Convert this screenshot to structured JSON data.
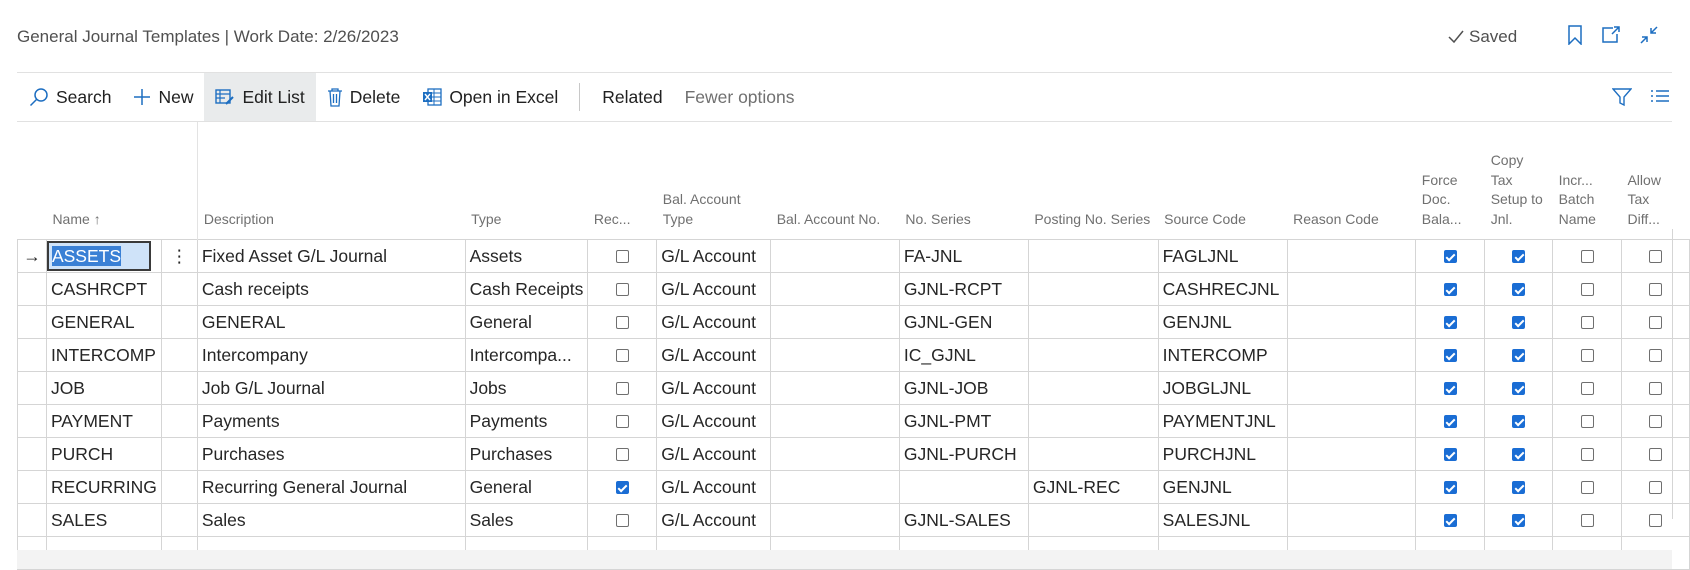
{
  "header": {
    "title": "General Journal Templates | Work Date: 2/26/2023",
    "saved_label": "Saved",
    "icons": [
      "bookmark-icon",
      "open-new-window-icon",
      "collapse-icon"
    ]
  },
  "actions": {
    "search": "Search",
    "new": "New",
    "edit_list": "Edit List",
    "delete": "Delete",
    "open_in_excel": "Open in Excel",
    "related": "Related",
    "fewer_options": "Fewer options",
    "icons": [
      "filter-icon",
      "list-view-icon"
    ]
  },
  "columns": {
    "name": "Name",
    "description": "Description",
    "type": "Type",
    "recurring": "Rec...",
    "bal_account_type": "Bal. Account Type",
    "bal_account_no": "Bal. Account No.",
    "no_series": "No. Series",
    "posting_no_series": "Posting No. Series",
    "source_code": "Source Code",
    "reason_code": "Reason Code",
    "force_doc_balance": "Force Doc. Bala...",
    "copy_tax_setup": "Copy Tax Setup to Jnl.",
    "incr_batch_name": "Incr... Batch Name",
    "allow_tax_diff": "Allow Tax Diff..."
  },
  "sort_indicator": "↑",
  "rows": [
    {
      "name": "ASSETS",
      "description": "Fixed Asset G/L Journal",
      "type": "Assets",
      "recurring": false,
      "bal_account_type": "G/L Account",
      "bal_account_no": "",
      "no_series": "FA-JNL",
      "posting_no_series": "",
      "source_code": "FAGLJNL",
      "reason_code": "",
      "force_doc_balance": true,
      "copy_tax_setup": true,
      "incr_batch_name": false,
      "allow_tax_diff": false
    },
    {
      "name": "CASHRCPT",
      "description": "Cash receipts",
      "type": "Cash Receipts",
      "recurring": false,
      "bal_account_type": "G/L Account",
      "bal_account_no": "",
      "no_series": "GJNL-RCPT",
      "posting_no_series": "",
      "source_code": "CASHRECJNL",
      "reason_code": "",
      "force_doc_balance": true,
      "copy_tax_setup": true,
      "incr_batch_name": false,
      "allow_tax_diff": false
    },
    {
      "name": "GENERAL",
      "description": "GENERAL",
      "type": "General",
      "recurring": false,
      "bal_account_type": "G/L Account",
      "bal_account_no": "",
      "no_series": "GJNL-GEN",
      "posting_no_series": "",
      "source_code": "GENJNL",
      "reason_code": "",
      "force_doc_balance": true,
      "copy_tax_setup": true,
      "incr_batch_name": false,
      "allow_tax_diff": false
    },
    {
      "name": "INTERCOMP",
      "description": "Intercompany",
      "type": "Intercompa...",
      "recurring": false,
      "bal_account_type": "G/L Account",
      "bal_account_no": "",
      "no_series": "IC_GJNL",
      "posting_no_series": "",
      "source_code": "INTERCOMP",
      "reason_code": "",
      "force_doc_balance": true,
      "copy_tax_setup": true,
      "incr_batch_name": false,
      "allow_tax_diff": false
    },
    {
      "name": "JOB",
      "description": "Job G/L Journal",
      "type": "Jobs",
      "recurring": false,
      "bal_account_type": "G/L Account",
      "bal_account_no": "",
      "no_series": "GJNL-JOB",
      "posting_no_series": "",
      "source_code": "JOBGLJNL",
      "reason_code": "",
      "force_doc_balance": true,
      "copy_tax_setup": true,
      "incr_batch_name": false,
      "allow_tax_diff": false
    },
    {
      "name": "PAYMENT",
      "description": "Payments",
      "type": "Payments",
      "recurring": false,
      "bal_account_type": "G/L Account",
      "bal_account_no": "",
      "no_series": "GJNL-PMT",
      "posting_no_series": "",
      "source_code": "PAYMENTJNL",
      "reason_code": "",
      "force_doc_balance": true,
      "copy_tax_setup": true,
      "incr_batch_name": false,
      "allow_tax_diff": false
    },
    {
      "name": "PURCH",
      "description": "Purchases",
      "type": "Purchases",
      "recurring": false,
      "bal_account_type": "G/L Account",
      "bal_account_no": "",
      "no_series": "GJNL-PURCH",
      "posting_no_series": "",
      "source_code": "PURCHJNL",
      "reason_code": "",
      "force_doc_balance": true,
      "copy_tax_setup": true,
      "incr_batch_name": false,
      "allow_tax_diff": false
    },
    {
      "name": "RECURRING",
      "description": "Recurring General Journal",
      "type": "General",
      "recurring": true,
      "bal_account_type": "G/L Account",
      "bal_account_no": "",
      "no_series": "",
      "posting_no_series": "GJNL-REC",
      "source_code": "GENJNL",
      "reason_code": "",
      "force_doc_balance": true,
      "copy_tax_setup": true,
      "incr_batch_name": false,
      "allow_tax_diff": false
    },
    {
      "name": "SALES",
      "description": "Sales",
      "type": "Sales",
      "recurring": false,
      "bal_account_type": "G/L Account",
      "bal_account_no": "",
      "no_series": "GJNL-SALES",
      "posting_no_series": "",
      "source_code": "SALESJNL",
      "reason_code": "",
      "force_doc_balance": true,
      "copy_tax_setup": true,
      "incr_batch_name": false,
      "allow_tax_diff": false
    }
  ],
  "selected_row": 0,
  "colors": {
    "accent": "#1a6dd4",
    "selection": "#3a80d5",
    "muted_text": "#707070"
  }
}
